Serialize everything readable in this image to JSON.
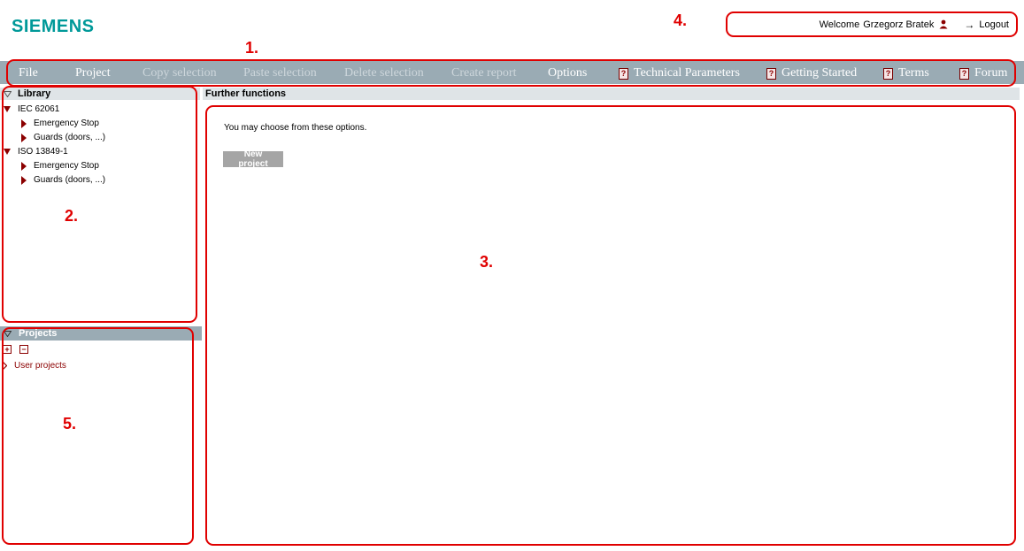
{
  "header": {
    "logo_text": "SIEMENS",
    "welcome_label": "Welcome",
    "user_name": "Grzegorz Bratek",
    "logout_label": "Logout"
  },
  "nav": {
    "items": [
      {
        "label": "File",
        "enabled": true,
        "help": false
      },
      {
        "label": "Project",
        "enabled": true,
        "help": false
      },
      {
        "label": "Copy selection",
        "enabled": false,
        "help": false
      },
      {
        "label": "Paste selection",
        "enabled": false,
        "help": false
      },
      {
        "label": "Delete selection",
        "enabled": false,
        "help": false
      },
      {
        "label": "Create report",
        "enabled": false,
        "help": false
      },
      {
        "label": "Options",
        "enabled": true,
        "help": false
      },
      {
        "label": "Technical Parameters",
        "enabled": true,
        "help": true
      },
      {
        "label": "Getting Started",
        "enabled": true,
        "help": true
      },
      {
        "label": "Terms",
        "enabled": true,
        "help": true
      },
      {
        "label": "Forum",
        "enabled": true,
        "help": true
      }
    ]
  },
  "library": {
    "title": "Library",
    "groups": [
      {
        "label": "IEC 62061",
        "children": [
          "Emergency Stop",
          "Guards (doors, ...)"
        ]
      },
      {
        "label": "ISO 13849-1",
        "children": [
          "Emergency Stop",
          "Guards (doors, ...)"
        ]
      }
    ]
  },
  "projects": {
    "title": "Projects",
    "expand_symbol": "+",
    "collapse_symbol": "−",
    "items": [
      "User projects"
    ]
  },
  "main": {
    "title": "Further functions",
    "message": "You may choose from these options.",
    "new_project_label": "New project"
  },
  "annotations": {
    "a1": "1.",
    "a2": "2.",
    "a3": "3.",
    "a4": "4.",
    "a5": "5."
  },
  "colors": {
    "brand": "#009999",
    "nav_bg": "#9aabb4",
    "panel_head_bg": "#dfe4e7",
    "annotation_red": "#e00000",
    "tree_marker": "#8b0000"
  }
}
